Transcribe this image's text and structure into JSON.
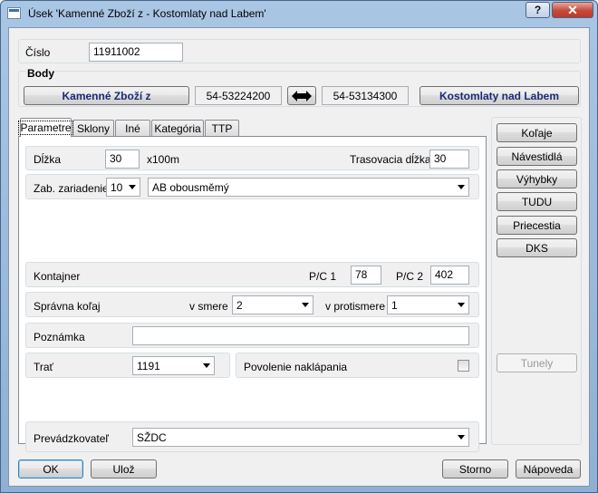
{
  "window": {
    "title": "Úsek 'Kamenné Zboží z - Kostomlaty nad Labem'",
    "help_label": "?",
    "close_label": "✕"
  },
  "cislo": {
    "label": "Číslo",
    "value": "11911002"
  },
  "body": {
    "label": "Body",
    "from_button": "Kamenné Zboží z",
    "from_code": "54-53224200",
    "to_code": "54-53134300",
    "to_button": "Kostomlaty nad Labem"
  },
  "tabs": [
    {
      "label": "Parametre"
    },
    {
      "label": "Sklony"
    },
    {
      "label": "Iné"
    },
    {
      "label": "Kategória"
    },
    {
      "label": "TTP"
    }
  ],
  "params": {
    "dlzka_label": "Dĺžka",
    "dlzka_value": "30",
    "dlzka_unit": "x100m",
    "trasovacia_label": "Trasovacia dĺžka",
    "trasovacia_value": "30",
    "zab_label": "Zab. zariadenie",
    "zab_num": "10",
    "zab_type": "AB obousměmý",
    "kontajner_label": "Kontajner",
    "pc1_label": "P/C 1",
    "pc1_value": "78",
    "pc2_label": "P/C 2",
    "pc2_value": "402",
    "spravna_label": "Správna koľaj",
    "v_smere_label": "v smere",
    "v_smere_value": "2",
    "v_protismere_label": "v protismere",
    "v_protismere_value": "1",
    "poznamka_label": "Poznámka",
    "poznamka_value": "",
    "trat_label": "Trať",
    "trat_value": "1191",
    "povolenie_label": "Povolenie naklápania",
    "prevadzkovatel_label": "Prevádzkovateľ",
    "prevadzkovatel_value": "SŽDC"
  },
  "side_buttons": {
    "kolaje": "Koľaje",
    "navestidla": "Návestidlá",
    "vyhybky": "Výhybky",
    "tudu": "TUDU",
    "priecestia": "Priecestia",
    "dks": "DKS",
    "tunely": "Tunely"
  },
  "footer": {
    "ok": "OK",
    "uloz": "Ulož",
    "storno": "Storno",
    "napoveda": "Nápoveda"
  }
}
